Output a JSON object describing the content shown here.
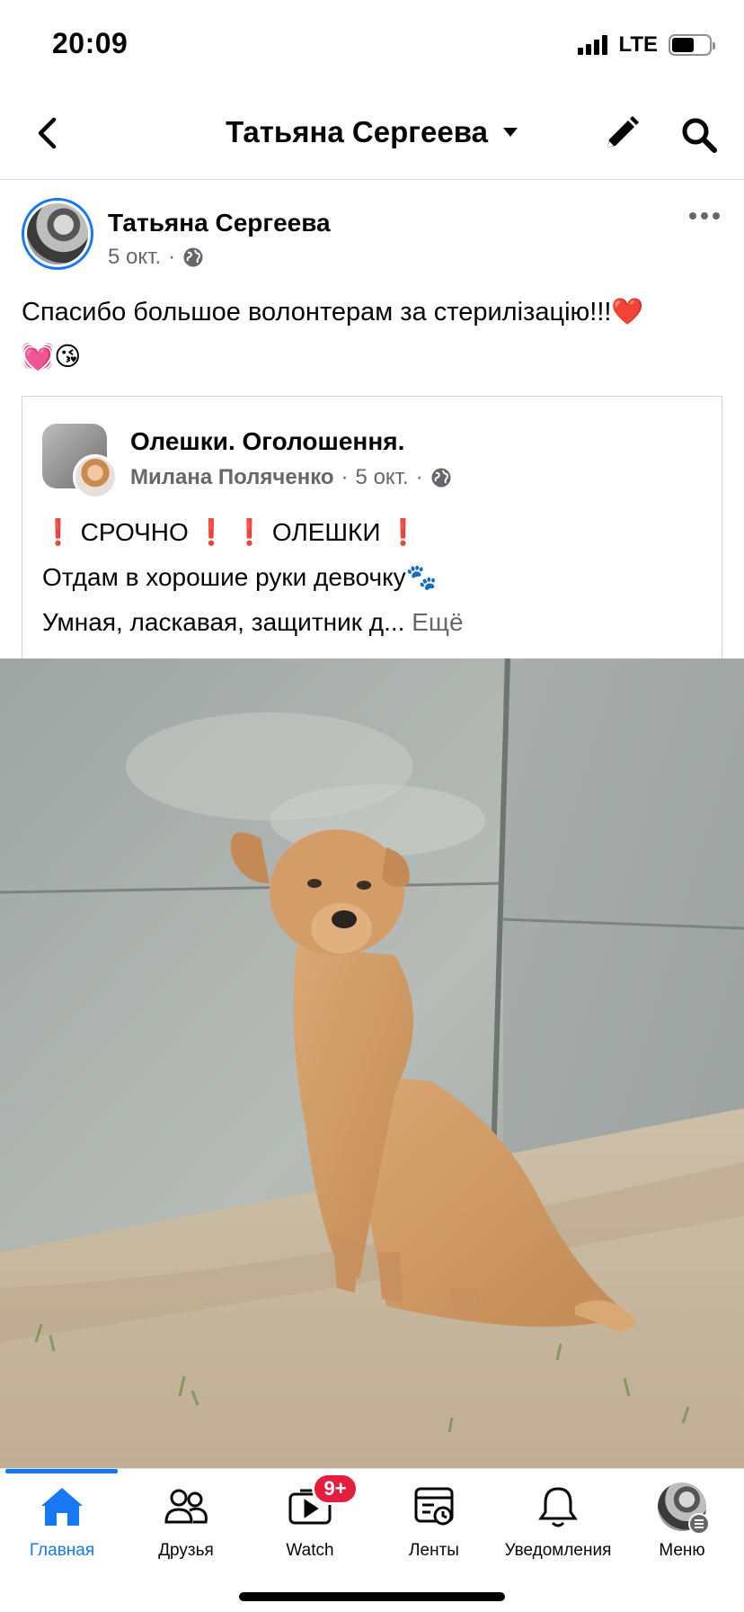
{
  "status_bar": {
    "time": "20:09",
    "network": "LTE"
  },
  "nav": {
    "title": "Татьяна Сергеева",
    "back_icon": "chevron-left-icon",
    "dropdown_icon": "caret-down-icon",
    "edit_icon": "pencil-icon",
    "search_icon": "search-icon"
  },
  "post": {
    "author": "Татьяна Сергеева",
    "date": "5 окт.",
    "separator": "·",
    "privacy_icon": "globe-icon",
    "text_line1": "Спасибо большое волонтерам за стерилізацію!!!❤️",
    "text_line2": "💓😘"
  },
  "shared": {
    "group_name": "Олешки. Оголошення.",
    "sharer": "Милана Поляченко",
    "separator": "·",
    "date": "5 окт.",
    "urgent_line": "СРОЧНО",
    "location_line": "ОЛЕШКИ",
    "excl_mark": "❗",
    "line2": "Отдам в хорошие руки девочку🐾",
    "line3": "Умная, ласкавая, защитник д...",
    "see_more": "Ещё"
  },
  "tabs": [
    {
      "label": "Главная",
      "icon": "home-icon",
      "active": true
    },
    {
      "label": "Друзья",
      "icon": "friends-icon"
    },
    {
      "label": "Watch",
      "icon": "watch-icon",
      "badge": "9+"
    },
    {
      "label": "Ленты",
      "icon": "feeds-icon"
    },
    {
      "label": "Уведомления",
      "icon": "bell-icon"
    },
    {
      "label": "Меню",
      "icon": "menu-avatar-icon"
    }
  ],
  "colors": {
    "accent": "#1877f2",
    "badge": "#e41e3f",
    "secondary_text": "#65676b",
    "urgent": "#d8222a"
  }
}
